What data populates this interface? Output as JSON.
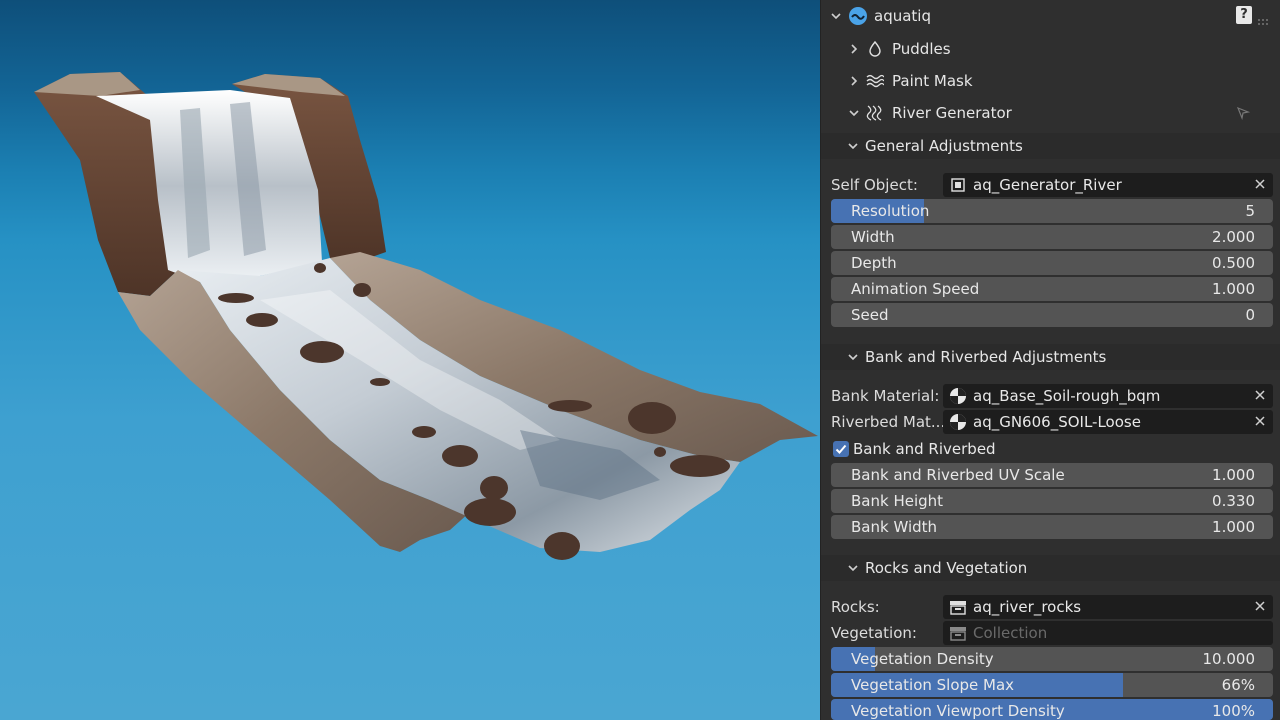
{
  "panel": {
    "addon_title": "aquatiq",
    "addon_items": [
      {
        "label": "Puddles",
        "icon": "droplet-icon"
      },
      {
        "label": "Paint Mask",
        "icon": "waves-icon"
      },
      {
        "label": "River Generator",
        "icon": "river-icon"
      }
    ],
    "general": {
      "title": "General Adjustments",
      "self_object_label": "Self Object:",
      "self_object_value": "aq_Generator_River",
      "sliders": [
        {
          "label": "Resolution",
          "value": "5",
          "fill": 0.21
        },
        {
          "label": "Width",
          "value": "2.000",
          "fill": 0
        },
        {
          "label": "Depth",
          "value": "0.500",
          "fill": 0
        },
        {
          "label": "Animation Speed",
          "value": "1.000",
          "fill": 0
        },
        {
          "label": "Seed",
          "value": "0",
          "fill": 0
        }
      ]
    },
    "bank": {
      "title": "Bank and Riverbed Adjustments",
      "bank_material_label": "Bank Material:",
      "bank_material_value": "aq_Base_Soil-rough_bqm",
      "riverbed_material_label": "Riverbed Mat...",
      "riverbed_material_value": "aq_GN606_SOIL-Loose",
      "checkbox_label": "Bank and Riverbed",
      "checkbox_checked": true,
      "sliders": [
        {
          "label": "Bank and Riverbed UV Scale",
          "value": "1.000",
          "fill": 0
        },
        {
          "label": "Bank Height",
          "value": "0.330",
          "fill": 0
        },
        {
          "label": "Bank Width",
          "value": "1.000",
          "fill": 0
        }
      ]
    },
    "rocks": {
      "title": "Rocks and Vegetation",
      "rocks_label": "Rocks:",
      "rocks_value": "aq_river_rocks",
      "vegetation_label": "Vegetation:",
      "vegetation_placeholder": "Collection",
      "sliders": [
        {
          "label": "Vegetation Density",
          "value": "10.000",
          "fill": 0.1
        },
        {
          "label": "Vegetation Slope Max",
          "value": "66%",
          "fill": 0.66
        },
        {
          "label": "Vegetation Viewport Density",
          "value": "100%",
          "fill": 1.0
        }
      ]
    }
  },
  "colors": {
    "accent": "#4772b3",
    "panel_bg": "#2f2f2f",
    "field_bg": "#1d1d1d",
    "slider_bg": "#545454",
    "viewport_sky": "#2691c4"
  }
}
